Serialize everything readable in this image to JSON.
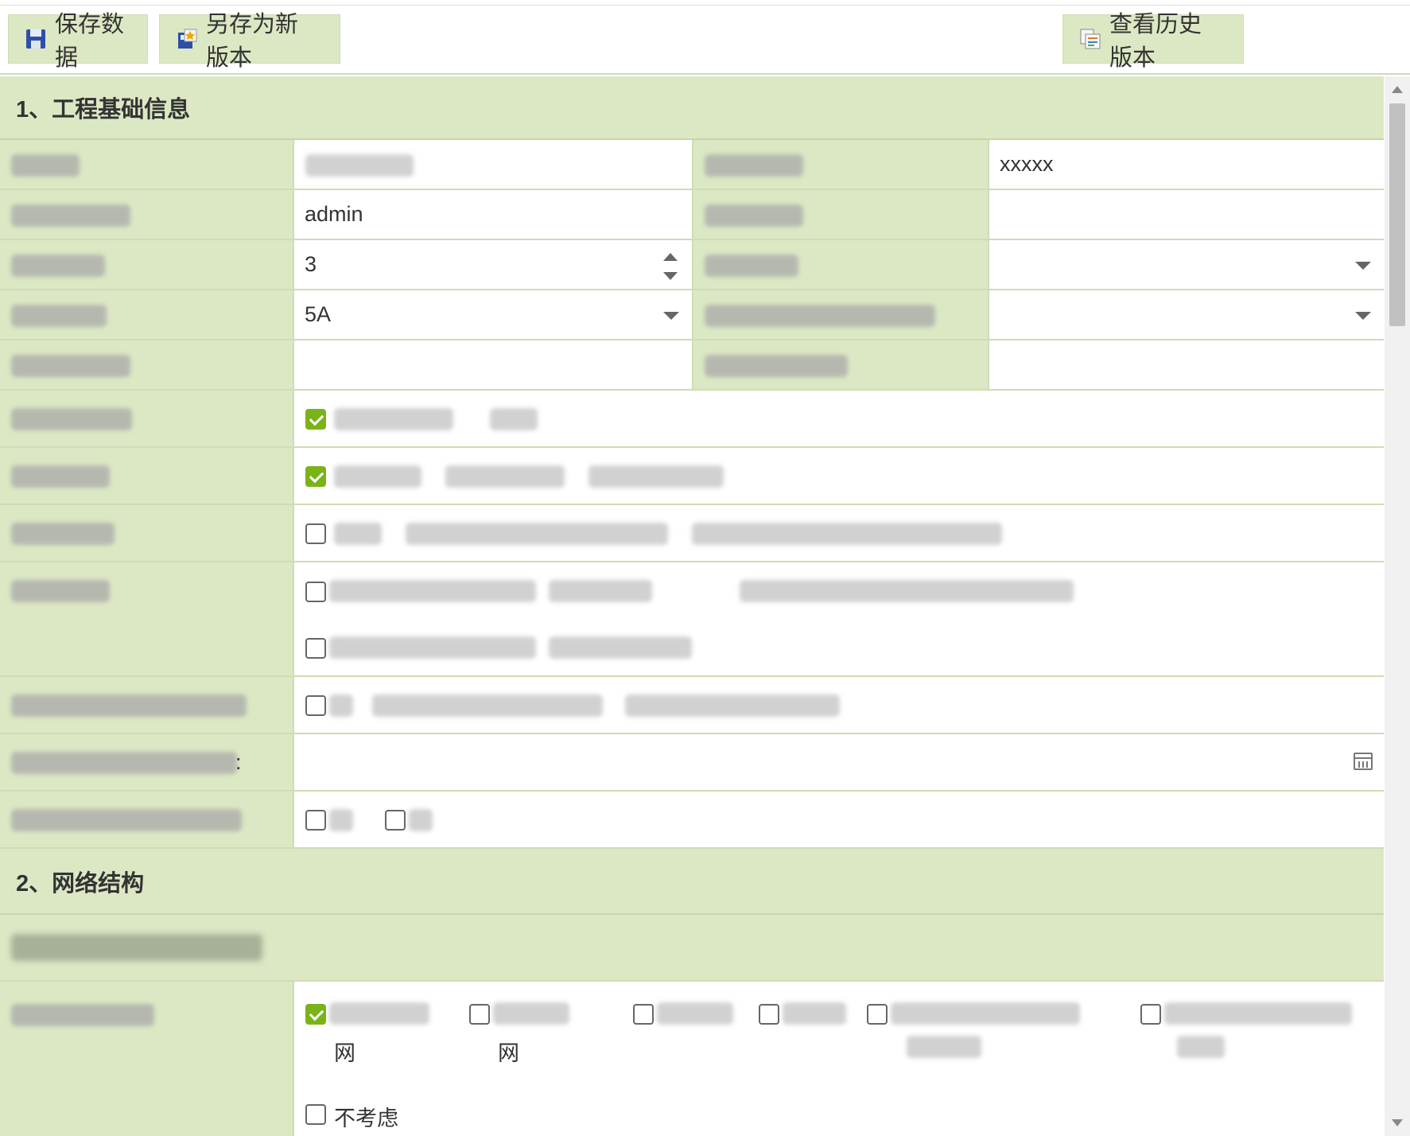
{
  "toolbar": {
    "save_label": "保存数据",
    "save_as_label": "另存为新版本",
    "history_label": "查看历史版本"
  },
  "sections": {
    "s1_title": "1、工程基础信息",
    "s2_title": "2、网络结构"
  },
  "form": {
    "right_value_row1": "xxxxx",
    "value_row2": "admin",
    "value_row3_number": "3",
    "value_row4_select": "5A",
    "datetime_label_suffix": ":"
  },
  "network": {
    "option_bottom_label": "不考虑",
    "option1_wrap": "网",
    "option2_wrap": "网"
  },
  "colors": {
    "label_bg": "#dce8c4",
    "border": "#cfdcb5",
    "checkbox_checked": "#7ab317"
  },
  "icons": {
    "save": "floppy-disk-icon",
    "save_as": "new-version-icon",
    "history": "history-icon"
  }
}
